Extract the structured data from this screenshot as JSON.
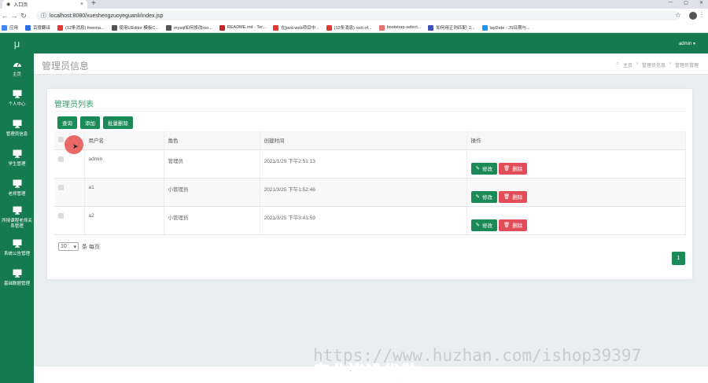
{
  "browser": {
    "tab_title": "入口页",
    "url": "localhost:8080/xueshengzuoyeguanli/index.jsp",
    "bookmarks": [
      {
        "label": "应用",
        "color": "#4285f4"
      },
      {
        "label": "百度翻译",
        "color": "#2f6fe4"
      },
      {
        "label": "(12条消息) freema...",
        "color": "#e53935"
      },
      {
        "label": "使用UEditor 模板C...",
        "color": "#555555"
      },
      {
        "label": "mysql如何修改roo...",
        "color": "#555555"
      },
      {
        "label": "README.md · Ter...",
        "color": "#c62828"
      },
      {
        "label": "在java web项目中...",
        "color": "#e53935"
      },
      {
        "label": "(12条消息) root of...",
        "color": "#e53935"
      },
      {
        "label": "bootstrap-select...",
        "color": "#e57373"
      },
      {
        "label": "如何用正则匹配: 2...",
        "color": "#3f51b5"
      },
      {
        "label": "layDate - JS日期与...",
        "color": "#2196f3"
      }
    ]
  },
  "sidebar": {
    "logo": "μ",
    "items": [
      {
        "label": "主页",
        "icon": "dashboard-icon"
      },
      {
        "label": "个人中心",
        "icon": "monitor-icon"
      },
      {
        "label": "管理员信息",
        "icon": "monitor-icon"
      },
      {
        "label": "学生管理",
        "icon": "monitor-icon"
      },
      {
        "label": "老师管理",
        "icon": "monitor-icon"
      },
      {
        "label": "所授课程老师关系管理",
        "icon": "monitor-icon"
      },
      {
        "label": "系统公告管理",
        "icon": "monitor-icon"
      },
      {
        "label": "基础数据管理",
        "icon": "monitor-icon"
      }
    ]
  },
  "topbar": {
    "user": "admin ▾"
  },
  "header": {
    "title": "管理员信息",
    "breadcrumb": [
      "主页",
      "管理员信息",
      "管理员管理"
    ]
  },
  "card": {
    "title": "管理员列表",
    "buttons": {
      "query": "查询",
      "add": "添加",
      "batch_delete": "批量删除"
    },
    "columns": [
      "",
      "用户名",
      "角色",
      "创建时间",
      "操作"
    ],
    "rows": [
      {
        "username": "admin",
        "role": "管理员",
        "created": "2021/1/29 下午2:51:13"
      },
      {
        "username": "a1",
        "role": "小管理员",
        "created": "2021/3/25 下午1:52:46"
      },
      {
        "username": "a2",
        "role": "小管理员",
        "created": "2021/3/25 下午3:41:59"
      }
    ],
    "edit_label": "修改",
    "delete_label": "删除",
    "page_size": "10",
    "page_size_suffix": "条 每页",
    "current_page": "1"
  },
  "overlay": {
    "watermark": "https://www.huzhan.com/ishop39397",
    "caption": "专业毕设代做"
  },
  "colors": {
    "primary": "#157a4d",
    "button_green": "#1a8a57",
    "button_red": "#e34d59",
    "title_green": "#2f9e6b"
  }
}
